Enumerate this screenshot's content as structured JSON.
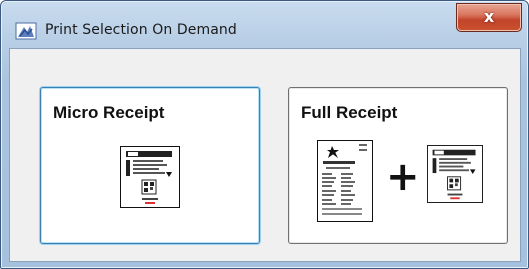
{
  "window": {
    "title": "Print Selection On Demand",
    "close_label": "x"
  },
  "options": {
    "micro": {
      "label": "Micro Receipt"
    },
    "full": {
      "label": "Full Receipt",
      "plus_symbol": "+"
    }
  },
  "icons": {
    "app": "printer-app-icon",
    "close": "close-icon",
    "micro_receipt": "micro-receipt-icon",
    "full_receipt": "full-receipt-icon"
  },
  "colors": {
    "titlebar": "#aac4df",
    "close_button": "#c9532f",
    "focus_border": "#3c7fb1"
  }
}
